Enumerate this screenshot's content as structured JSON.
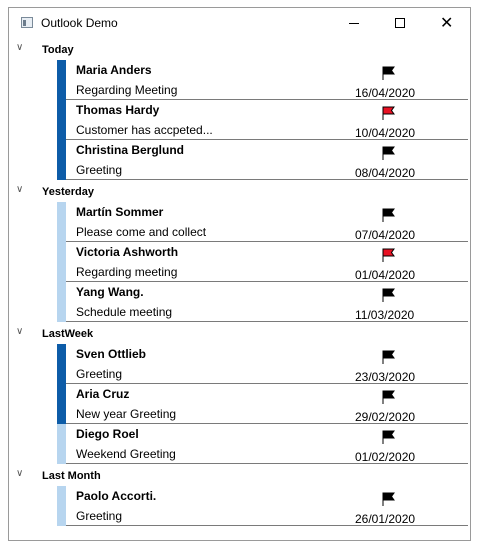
{
  "window": {
    "title": "Outlook Demo"
  },
  "groups": [
    {
      "label": "Today",
      "items": [
        {
          "sender": "Maria Anders",
          "subject": "Regarding Meeting",
          "date": "16/04/2020",
          "flag_color": "#000000",
          "read": false
        },
        {
          "sender": "Thomas Hardy",
          "subject": "Customer has accpeted...",
          "date": "10/04/2020",
          "flag_color": "#e81123",
          "read": false
        },
        {
          "sender": "Christina Berglund",
          "subject": "Greeting",
          "date": "08/04/2020",
          "flag_color": "#000000",
          "read": false
        }
      ]
    },
    {
      "label": "Yesterday",
      "items": [
        {
          "sender": "Martín Sommer",
          "subject": "Please come and collect",
          "date": "07/04/2020",
          "flag_color": "#000000",
          "read": true
        },
        {
          "sender": "Victoria Ashworth",
          "subject": "Regarding meeting",
          "date": "01/04/2020",
          "flag_color": "#e81123",
          "read": true
        },
        {
          "sender": "Yang Wang.",
          "subject": "Schedule meeting",
          "date": "11/03/2020",
          "flag_color": "#000000",
          "read": true
        }
      ]
    },
    {
      "label": "LastWeek",
      "items": [
        {
          "sender": "Sven Ottlieb",
          "subject": "Greeting",
          "date": "23/03/2020",
          "flag_color": "#000000",
          "read": false
        },
        {
          "sender": "Aria Cruz",
          "subject": "New year Greeting",
          "date": "29/02/2020",
          "flag_color": "#000000",
          "read": false
        },
        {
          "sender": "Diego Roel",
          "subject": "Weekend Greeting",
          "date": "01/02/2020",
          "flag_color": "#000000",
          "read": true
        }
      ]
    },
    {
      "label": "Last Month",
      "items": [
        {
          "sender": "Paolo Accorti.",
          "subject": "Greeting",
          "date": "26/01/2020",
          "flag_color": "#000000",
          "read": true
        }
      ]
    }
  ]
}
